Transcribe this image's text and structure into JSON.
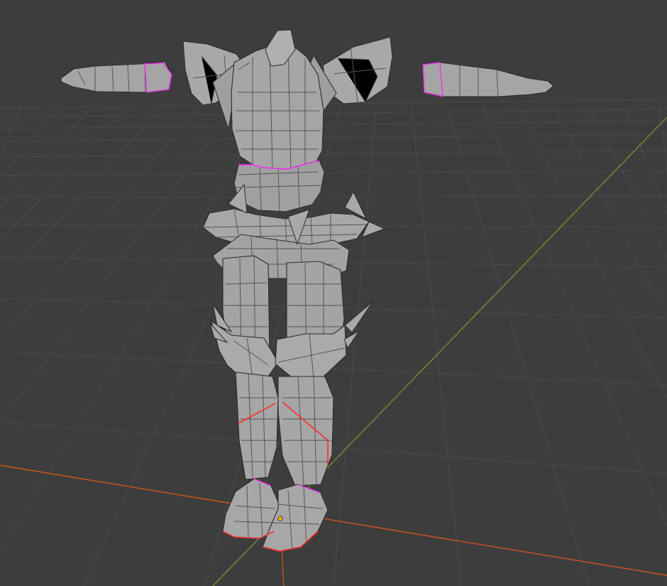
{
  "viewport": {
    "editor": "3d-viewport",
    "shading": "solid",
    "overlays": [
      "wireframe",
      "grid-floor"
    ]
  },
  "colors": {
    "background": "#3d3d3d",
    "grid_line": "#4a4a4a",
    "x_axis": "#d0541e",
    "y_axis": "#6f9a2e",
    "mesh_fill": "#a4a4a4",
    "mesh_edge": "#2a2a2a",
    "seam": "#ff2a2a",
    "selected_edge": "#ff24ff",
    "origin": "#ffb000"
  },
  "scene": {
    "object_type": "armor",
    "parts": [
      "left-gauntlet",
      "right-gauntlet",
      "left-pauldron",
      "right-pauldron",
      "breastplate",
      "waist-plate",
      "faulds",
      "left-greave",
      "right-greave",
      "left-sabaton",
      "right-sabaton"
    ]
  }
}
